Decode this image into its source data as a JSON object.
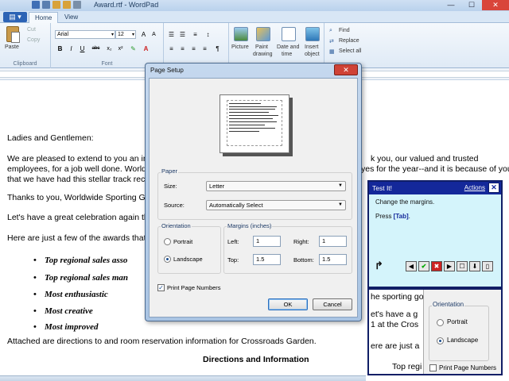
{
  "window": {
    "title": "Award.rtf - WordPad",
    "minimize_glyph": "—",
    "maximize_glyph": "☐",
    "close_glyph": "✕"
  },
  "ribbon": {
    "app_button_glyph": "▤ ▾",
    "tabs": [
      "Home",
      "View"
    ],
    "clipboard": {
      "paste": "Paste",
      "cut": "Cut",
      "copy": "Copy",
      "label": "Clipboard"
    },
    "font": {
      "family": "Arial",
      "size": "12",
      "label": "Font",
      "bold": "B",
      "italic": "I",
      "underline": "U",
      "strike": "abc"
    },
    "insert": {
      "picture": "Picture",
      "paint": "Paint",
      "drawing": "drawing",
      "date": "Date and",
      "time": "time",
      "insert": "Insert",
      "object": "object"
    },
    "editing": {
      "find": "Find",
      "replace": "Replace",
      "select_all": "Select all"
    }
  },
  "document": {
    "greeting": "Ladies and Gentlemen:",
    "p1_line1_a": "We are pleased to extend to you an invita",
    "p1_line1_b": "k you, our valued and trusted",
    "p1_line2_a": "employees, for a job well done.  Worldwid",
    "p1_line2_b": "yes for the year--and it is because of you",
    "p1_line3": "that we have had this stellar track record.",
    "p2": "Thanks to you, Worldwide Sporting Good",
    "p3": "Let's have a great celebration again this",
    "p4": "Here are just a few of the awards that will",
    "bullets": [
      "Top regional sales asso",
      "Top regional sales man",
      "Most enthusiastic",
      "Most creative",
      "Most improved"
    ],
    "p5": "Attached are directions to and room reservation information for Crossroads Garden.",
    "heading": "Directions and Information"
  },
  "dialog": {
    "title": "Page Setup",
    "close_glyph": "✕",
    "paper": {
      "legend": "Paper",
      "size_label": "Size:",
      "size_value": "Letter",
      "source_label": "Source:",
      "source_value": "Automatically Select"
    },
    "orientation": {
      "legend": "Orientation",
      "portrait": "Portrait",
      "landscape": "Landscape",
      "selected": "Landscape"
    },
    "margins": {
      "legend": "Margins (inches)",
      "left_label": "Left:",
      "left": "1",
      "right_label": "Right:",
      "right": "1",
      "top_label": "Top:",
      "top": "1.5",
      "bottom_label": "Bottom:",
      "bottom": "1.5"
    },
    "print_page_numbers": "Print Page Numbers",
    "print_page_numbers_checked": true,
    "check_glyph": "✓",
    "ok": "OK",
    "cancel": "Cancel"
  },
  "testit": {
    "title": "Test It!",
    "actions": "Actions",
    "close_glyph": "✕",
    "instruction": "Change the margins.",
    "press": "Press ",
    "key": "[Tab]",
    "key_suffix": ".",
    "nav_glyph": "↱",
    "buttons": [
      "◀",
      "✔",
      "✖",
      "▶",
      "☐",
      "⬇",
      "▯"
    ]
  },
  "zoom": {
    "lines": [
      "he sporting go",
      "et's have a g",
      "1 at the Cros",
      "ere are just a",
      "Top regi"
    ],
    "orientation": "Orientation",
    "portrait": "Portrait",
    "landscape": "Landscape",
    "print_page_numbers": "Print Page Numbers"
  },
  "colors": {
    "accent": "#14289a",
    "dialog_frame": "#a9c4e3",
    "testit_bg": "#d4f4fb",
    "close_red": "#cf4236"
  }
}
